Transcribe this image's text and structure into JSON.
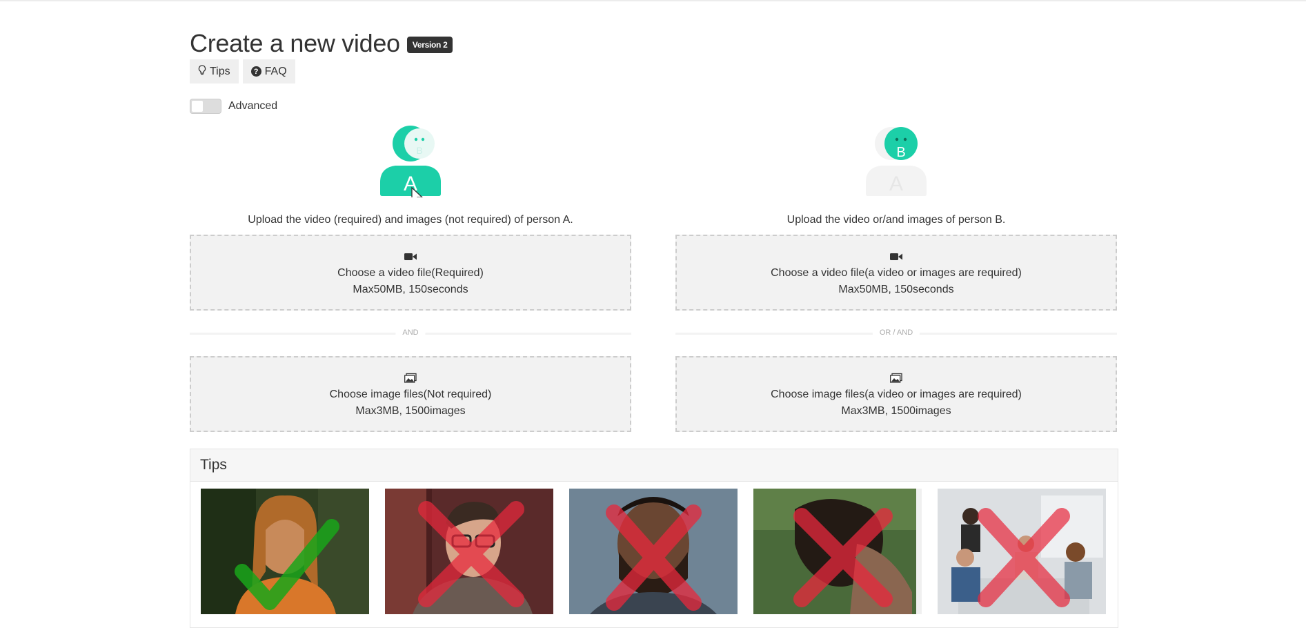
{
  "header": {
    "title": "Create a new video",
    "version_badge": "Version 2",
    "tips_button": "Tips",
    "faq_button": "FAQ"
  },
  "advanced_toggle": {
    "label": "Advanced",
    "state": "off"
  },
  "person_a": {
    "avatar_front_letter": "A",
    "avatar_back_letter": "B",
    "instruction": "Upload the video (required) and images (not required) of person A.",
    "video_upload": {
      "label": "Choose a video file(Required)",
      "limits": "Max50MB, 150seconds"
    },
    "separator": "AND",
    "image_upload": {
      "label": "Choose image files(Not required)",
      "limits": "Max3MB, 1500images"
    }
  },
  "person_b": {
    "avatar_front_letter": "B",
    "avatar_back_letter": "A",
    "instruction": "Upload the video or/and images of person B.",
    "video_upload": {
      "label": "Choose a video file(a video or images are required)",
      "limits": "Max50MB, 150seconds"
    },
    "separator": "OR / AND",
    "image_upload": {
      "label": "Choose image files(a video or images are required)",
      "limits": "Max3MB, 1500images"
    }
  },
  "tips": {
    "heading": "Tips",
    "examples": [
      {
        "mark": "check"
      },
      {
        "mark": "cross"
      },
      {
        "mark": "cross"
      },
      {
        "mark": "cross"
      },
      {
        "mark": "cross"
      }
    ]
  },
  "colors": {
    "accent": "#1ccfa8",
    "accent_faded": "#cdf3ea",
    "check": "#1aa51a",
    "cross": "#e8283c"
  }
}
